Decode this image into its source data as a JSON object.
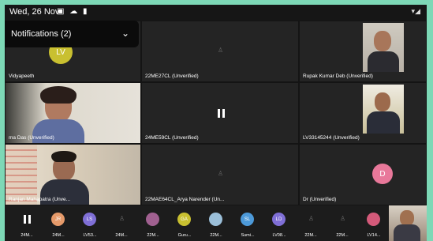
{
  "status_bar": {
    "time": "Wed, 26 Nov",
    "icons": "▣ ☁ ▮",
    "signal": "▾◢"
  },
  "notifications": {
    "label": "Notifications (2)",
    "chevron": "⌄"
  },
  "tiles": [
    {
      "label": "Vidyapeeth",
      "avatar": "LV",
      "color": "#c9c030"
    },
    {
      "label": "22ME27CL  (Unverified)"
    },
    {
      "label": "Rupak Kumar Deb (Unverified)"
    },
    {
      "label": "ma Das (Unverified)"
    },
    {
      "label": "24ME59CL  (Unverified)"
    },
    {
      "label": "LV33145244 (Unverified)"
    },
    {
      "label": "Ranjan Mahapatra (Unve..."
    },
    {
      "label": "22MAE64CL_Arya Narender (Un..."
    },
    {
      "label": "Dr (Unverified)",
      "avatar": "D",
      "color": "#e8789a"
    }
  ],
  "strip": [
    {
      "label": "24M...",
      "initials": "",
      "color": ""
    },
    {
      "label": "24M...",
      "initials": "JR",
      "color": "#e59a6a"
    },
    {
      "label": "LV53...",
      "initials": "LS",
      "color": "#7f6fd6"
    },
    {
      "label": "24M...",
      "initials": "",
      "color": ""
    },
    {
      "label": "22M...",
      "initials": "",
      "color": "#a06090"
    },
    {
      "label": "Guru...",
      "initials": "GA",
      "color": "#c9c030"
    },
    {
      "label": "22M...",
      "initials": "",
      "color": "#9bbfd9"
    },
    {
      "label": "Sumi...",
      "initials": "SL",
      "color": "#4d9ad9"
    },
    {
      "label": "LV08...",
      "initials": "LD",
      "color": "#7f6fd6"
    },
    {
      "label": "22M...",
      "initials": "",
      "color": ""
    },
    {
      "label": "22M...",
      "initials": "",
      "color": ""
    },
    {
      "label": "LV14...",
      "initials": "",
      "color": "#d45a7a"
    }
  ]
}
